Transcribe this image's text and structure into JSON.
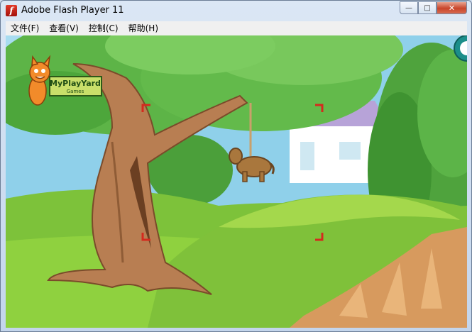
{
  "window": {
    "title": "Adobe Flash Player 11",
    "controls": {
      "minimize": "—",
      "maximize": "□",
      "close": "✕"
    }
  },
  "menu": {
    "items": [
      {
        "label": "文件(F)"
      },
      {
        "label": "查看(V)"
      },
      {
        "label": "控制(C)"
      },
      {
        "label": "帮助(H)"
      }
    ]
  },
  "game": {
    "logo": {
      "line1": "MyPlayYard",
      "line2": "Games"
    }
  },
  "colors": {
    "sky": "#8fd0ea",
    "foliage": "#5fb84a",
    "grass": "#8fcc3d",
    "trunk": "#b87e52",
    "marker": "#d42a1e"
  }
}
